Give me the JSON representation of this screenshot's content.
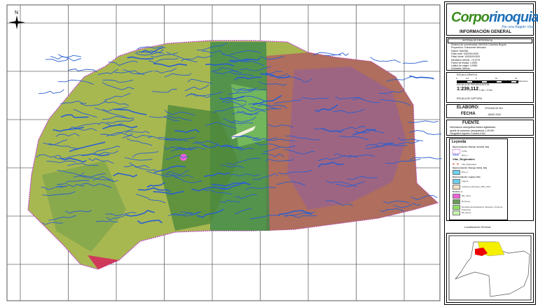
{
  "panel": {
    "logo": {
      "name_a": "Corpo",
      "name_b": "rinoquia",
      "tagline": "Por una Región Viva"
    },
    "title": "INFORMACIÓN GENERAL",
    "reference": {
      "header": "SISTEMA DE REFERENCIA",
      "lines": [
        "Sistema de coordenadas: MAGNA Colombia Bogota",
        "Proyección: Transverse Mercator",
        "Datum: MAGNA",
        "Falso este: 1000000.0000",
        "Falso Norte: 1000000.0000",
        "Meridiano central: -74.0775",
        "Factor de escala: 1.0000",
        "Latitud de origen: 4.5962",
        "Unidades: Metros"
      ]
    },
    "scale": {
      "graphic_label": "ESCALA GRAFICA",
      "ticks": [
        "0",
        "2.5",
        "5",
        "10",
        "15"
      ],
      "unit": "Kilometers",
      "presentation_label": "ESCALA DE PRESENTACIÓN",
      "ratio": "1:239,112",
      "equivalence": "1 cm = 2 km",
      "capture_label": "ESCALA DE CAPTURA"
    },
    "credits": {
      "made_by_label": "ELABORÓ:",
      "made_by": "OFICINA DE SIG",
      "date_label": "FECHA",
      "date": "JUNIO 2018"
    },
    "source": {
      "title": "FUENTE",
      "lines": [
        "Información cartográfica básica digitalizada",
        "apartir de planchas cartográficas 1:25.000",
        "Geográfico Agustín Codazzi-IGAC"
      ]
    },
    "legend": {
      "title": "Leyenda",
      "items": [
        {
          "kind": "heading",
          "label": "Representación: Drenaje_Sencillo_Etiq"
        },
        {
          "kind": "dots",
          "label": "Límite",
          "color": "#c040d0"
        },
        {
          "kind": "line",
          "label": "Ríos_1",
          "color": "#2a5fd0"
        },
        {
          "kind": "section",
          "label": "Vias_Regionales"
        },
        {
          "kind": "dash",
          "label": "Vias_Regionales",
          "color": "#d03030"
        },
        {
          "kind": "heading",
          "label": "Representación: Drenaje_Doble_Etiq"
        },
        {
          "kind": "fill",
          "label": "Ríos_2",
          "color": "#6ad0f0"
        },
        {
          "kind": "heading",
          "label": "Representación: Laguna_Etiq"
        },
        {
          "kind": "fill",
          "label": "Laguna",
          "color": "#6ad0f0"
        },
        {
          "kind": "fill",
          "label": "Cobertura_Municipio_2007_2017",
          "color": "#f2e2c4"
        },
        {
          "kind": "heading",
          "label": "Nombre_4"
        },
        {
          "kind": "fill",
          "label": "Bst_Tierra",
          "color": "#f060d8"
        },
        {
          "kind": "fill",
          "label": "Bt_Densy",
          "color": "#6a9a5a"
        },
        {
          "kind": "fill",
          "label": "Ecosistemas Estratégicos, Bosques y Áreas de Protección",
          "color": "#8ee060"
        },
        {
          "kind": "fill",
          "label": "Bst_Densy",
          "color": "#c8f5b0"
        }
      ]
    },
    "location": {
      "title": "Localización General"
    }
  },
  "map": {
    "north_label": "N",
    "colors": {
      "drainage": "#2a5fd0",
      "boundary": "#c040d0"
    }
  }
}
